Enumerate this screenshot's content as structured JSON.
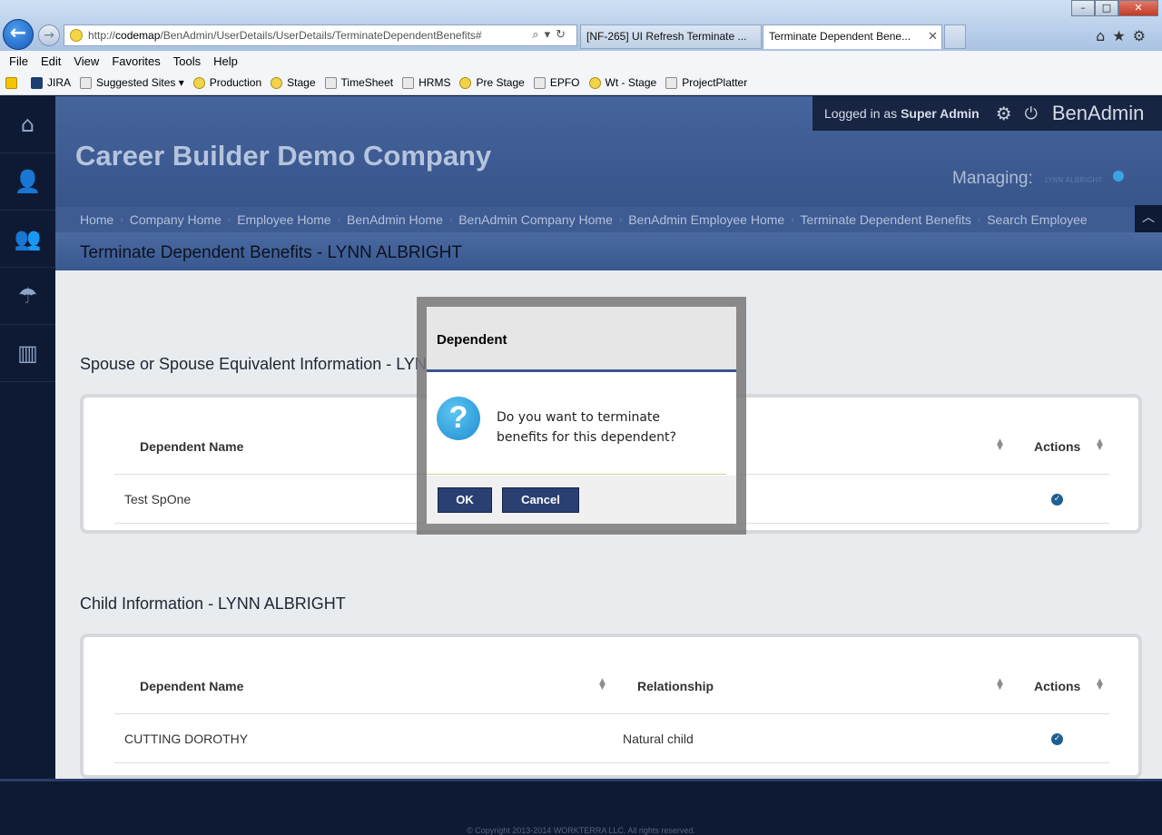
{
  "browser": {
    "address_prefix": "http://",
    "address_host": "codemap",
    "address_path": "/BenAdmin/UserDetails/UserDetails/TerminateDependentBenefits#",
    "tabs": [
      {
        "label": "[NF-265] UI Refresh Terminate ..."
      },
      {
        "label": "Terminate Dependent Bene..."
      }
    ],
    "menu": [
      "File",
      "Edit",
      "View",
      "Favorites",
      "Tools",
      "Help"
    ],
    "favorites": [
      "JIRA",
      "Suggested Sites",
      "Production",
      "Stage",
      "TimeSheet",
      "HRMS",
      "Pre Stage",
      "EPFO",
      "Wt - Stage",
      "ProjectPlatter"
    ]
  },
  "header": {
    "company": "Career Builder Demo Company",
    "logged_in_prefix": "Logged in as",
    "user": "Super Admin",
    "app_name": "BenAdmin",
    "managing_label": "Managing:",
    "managing_value": "LYNN ALBRIGHT"
  },
  "breadcrumb": [
    "Home",
    "Company Home",
    "Employee Home",
    "BenAdmin Home",
    "BenAdmin Company Home",
    "BenAdmin Employee Home",
    "Terminate Dependent Benefits",
    "Search Employee"
  ],
  "page_title": "Terminate Dependent Benefits - LYNN ALBRIGHT",
  "spouse_section": {
    "title": "Spouse or Spouse Equivalent Information - LYNN ALBRIGHT",
    "headers": [
      "Dependent Name",
      "Actions"
    ],
    "rows": [
      {
        "name": "Test SpOne"
      }
    ]
  },
  "child_section": {
    "title": "Child Information - LYNN ALBRIGHT",
    "headers": [
      "Dependent Name",
      "Relationship",
      "Actions"
    ],
    "rows": [
      {
        "name": "CUTTING DOROTHY",
        "relationship": "Natural child"
      }
    ]
  },
  "modal": {
    "title": "Dependent",
    "message": "Do you want to terminate benefits for this dependent?",
    "ok": "OK",
    "cancel": "Cancel"
  },
  "footer": {
    "copyright": "© Copyright 2013-2014 WORKTERRA LLC. All rights reserved."
  },
  "icons": {
    "nav": [
      "home-icon",
      "user-icon",
      "users-icon",
      "benefits-icon",
      "chart-icon"
    ]
  },
  "colors": {
    "accent": "#2a4072",
    "sidebar": "#0e1a33",
    "header": "#3e5b92"
  }
}
